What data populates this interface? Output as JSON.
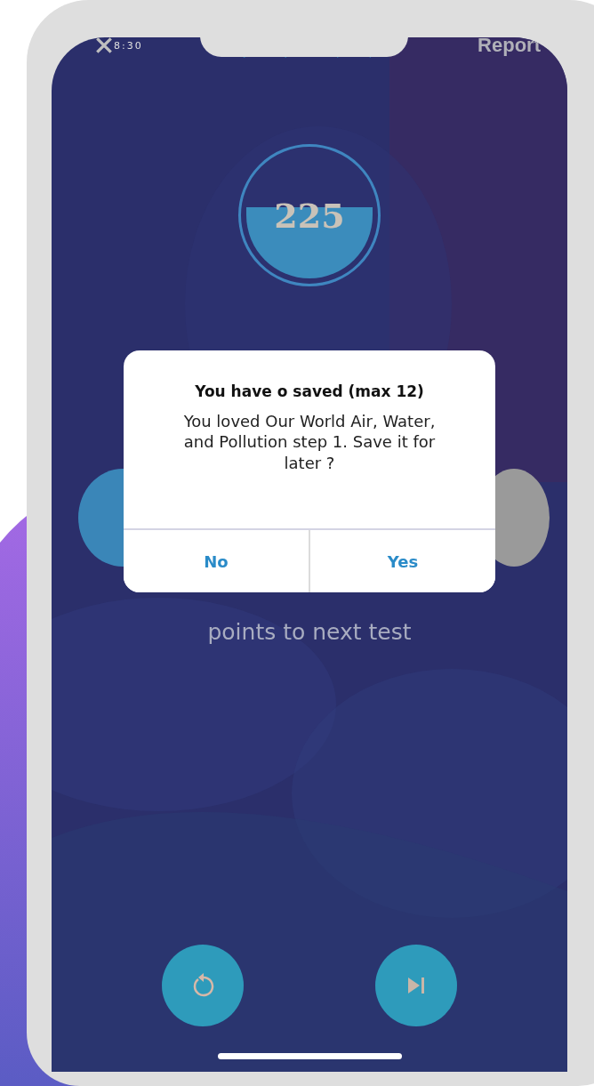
{
  "status_bar": {
    "time": "8:30"
  },
  "header": {
    "report": "Report"
  },
  "score": {
    "value": "225"
  },
  "dialog": {
    "title": "You have o saved (max 12)",
    "message": "You loved Our World Air, Water, and Pollution step 1. Save it for later ?",
    "buttons": [
      {
        "label": "No"
      },
      {
        "label": "Yes"
      }
    ]
  },
  "progress": {
    "caption": "points to next test"
  },
  "controls": [
    {
      "kind": "restart"
    },
    {
      "kind": "skip"
    }
  ]
}
